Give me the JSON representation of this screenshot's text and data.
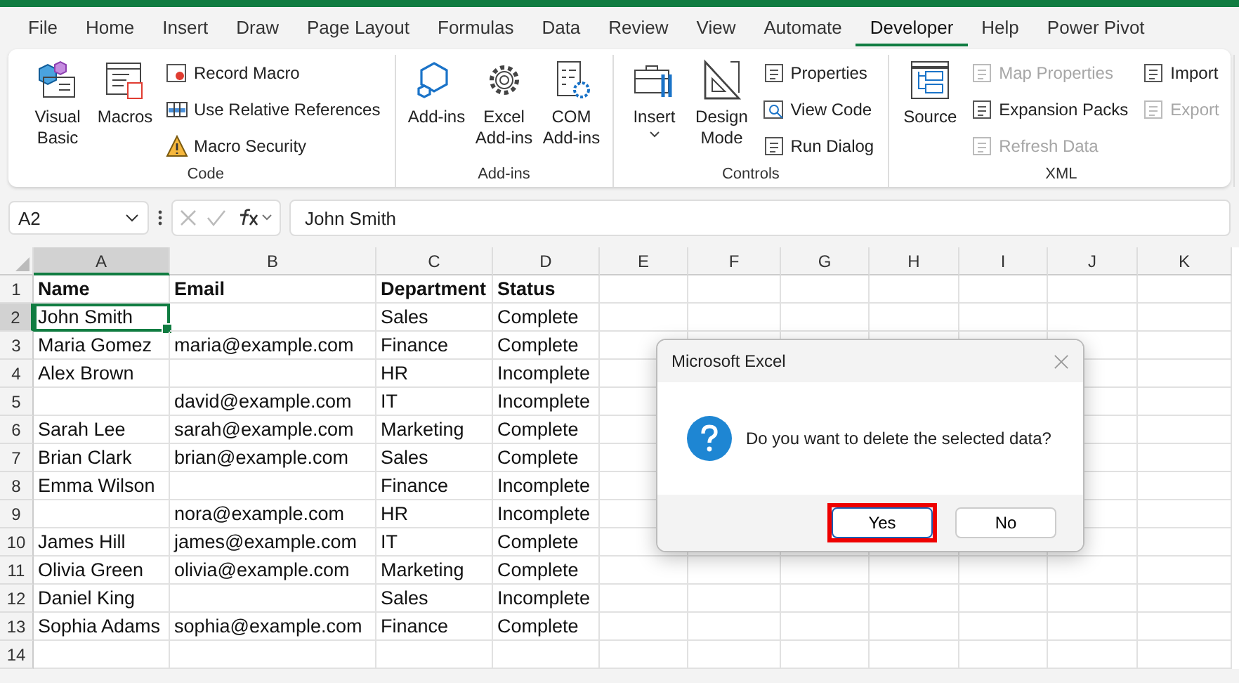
{
  "tabs": [
    {
      "label": "File",
      "selected": false
    },
    {
      "label": "Home",
      "selected": false
    },
    {
      "label": "Insert",
      "selected": false
    },
    {
      "label": "Draw",
      "selected": false
    },
    {
      "label": "Page Layout",
      "selected": false
    },
    {
      "label": "Formulas",
      "selected": false
    },
    {
      "label": "Data",
      "selected": false
    },
    {
      "label": "Review",
      "selected": false
    },
    {
      "label": "View",
      "selected": false
    },
    {
      "label": "Automate",
      "selected": false
    },
    {
      "label": "Developer",
      "selected": true
    },
    {
      "label": "Help",
      "selected": false
    },
    {
      "label": "Power Pivot",
      "selected": false
    }
  ],
  "ribbon": [
    {
      "label": "Code",
      "large": [
        {
          "label": "Visual Basic",
          "dropdown": false
        },
        {
          "label": "Macros",
          "dropdown": false
        }
      ],
      "small": [
        [
          {
            "label": "Record Macro",
            "disabled": false
          },
          {
            "label": "Use Relative References",
            "disabled": false
          },
          {
            "label": "Macro Security",
            "disabled": false
          }
        ]
      ]
    },
    {
      "label": "Add-ins",
      "large": [
        {
          "label": "Add-ins",
          "dropdown": false
        },
        {
          "label": "Excel Add-ins",
          "dropdown": false
        },
        {
          "label": "COM Add-ins",
          "dropdown": false
        }
      ]
    },
    {
      "label": "Controls",
      "large": [
        {
          "label": "Insert",
          "dropdown": true
        },
        {
          "label": "Design Mode",
          "dropdown": false
        }
      ],
      "small": [
        [
          {
            "label": "Properties",
            "disabled": false
          },
          {
            "label": "View Code",
            "disabled": false
          },
          {
            "label": "Run Dialog",
            "disabled": false
          }
        ]
      ]
    },
    {
      "label": "XML",
      "large": [
        {
          "label": "Source",
          "dropdown": false
        }
      ],
      "small": [
        [
          {
            "label": "Map Properties",
            "disabled": true
          },
          {
            "label": "Expansion Packs",
            "disabled": false
          },
          {
            "label": "Refresh Data",
            "disabled": true
          }
        ],
        [
          {
            "label": "Import",
            "disabled": false
          },
          {
            "label": "Export",
            "disabled": true
          }
        ]
      ]
    }
  ],
  "formula_bar": {
    "name_box": "A2",
    "value": "John Smith"
  },
  "columns": [
    {
      "label": "A",
      "selected": true
    },
    {
      "label": "B",
      "selected": false
    },
    {
      "label": "C",
      "selected": false
    },
    {
      "label": "D",
      "selected": false
    },
    {
      "label": "E",
      "selected": false
    },
    {
      "label": "F",
      "selected": false
    },
    {
      "label": "G",
      "selected": false
    },
    {
      "label": "H",
      "selected": false
    },
    {
      "label": "I",
      "selected": false
    },
    {
      "label": "J",
      "selected": false
    },
    {
      "label": "K",
      "selected": false
    }
  ],
  "rows": [
    {
      "number": "1",
      "selected": false,
      "cells": {
        "A": "Name",
        "B": "Email",
        "C": "Department",
        "D": "Status"
      }
    },
    {
      "number": "2",
      "selected": true,
      "cells": {
        "A": "John Smith",
        "C": "Sales",
        "D": "Complete"
      }
    },
    {
      "number": "3",
      "selected": false,
      "cells": {
        "A": "Maria Gomez",
        "B": "maria@example.com",
        "C": "Finance",
        "D": "Complete"
      }
    },
    {
      "number": "4",
      "selected": false,
      "cells": {
        "A": "Alex Brown",
        "C": "HR",
        "D": "Incomplete"
      }
    },
    {
      "number": "5",
      "selected": false,
      "cells": {
        "B": "david@example.com",
        "C": "IT",
        "D": "Incomplete"
      }
    },
    {
      "number": "6",
      "selected": false,
      "cells": {
        "A": "Sarah Lee",
        "B": "sarah@example.com",
        "C": "Marketing",
        "D": "Complete"
      }
    },
    {
      "number": "7",
      "selected": false,
      "cells": {
        "A": "Brian Clark",
        "B": "brian@example.com",
        "C": "Sales",
        "D": "Complete"
      }
    },
    {
      "number": "8",
      "selected": false,
      "cells": {
        "A": "Emma Wilson",
        "C": "Finance",
        "D": "Incomplete"
      }
    },
    {
      "number": "9",
      "selected": false,
      "cells": {
        "B": "nora@example.com",
        "C": "HR",
        "D": "Incomplete"
      }
    },
    {
      "number": "10",
      "selected": false,
      "cells": {
        "A": "James Hill",
        "B": "james@example.com",
        "C": "IT",
        "D": "Complete"
      }
    },
    {
      "number": "11",
      "selected": false,
      "cells": {
        "A": "Olivia Green",
        "B": "olivia@example.com",
        "C": "Marketing",
        "D": "Complete"
      }
    },
    {
      "number": "12",
      "selected": false,
      "cells": {
        "A": "Daniel King",
        "C": "Sales",
        "D": "Incomplete"
      }
    },
    {
      "number": "13",
      "selected": false,
      "cells": {
        "A": "Sophia Adams",
        "B": "sophia@example.com",
        "C": "Finance",
        "D": "Complete"
      }
    },
    {
      "number": "14",
      "selected": false,
      "cells": {}
    }
  ],
  "dialog": {
    "title": "Microsoft Excel",
    "message": "Do you want to delete the selected data?",
    "buttons": [
      {
        "label": "Yes",
        "focused": true,
        "highlighted": true
      },
      {
        "label": "No",
        "focused": false,
        "highlighted": false
      }
    ]
  }
}
